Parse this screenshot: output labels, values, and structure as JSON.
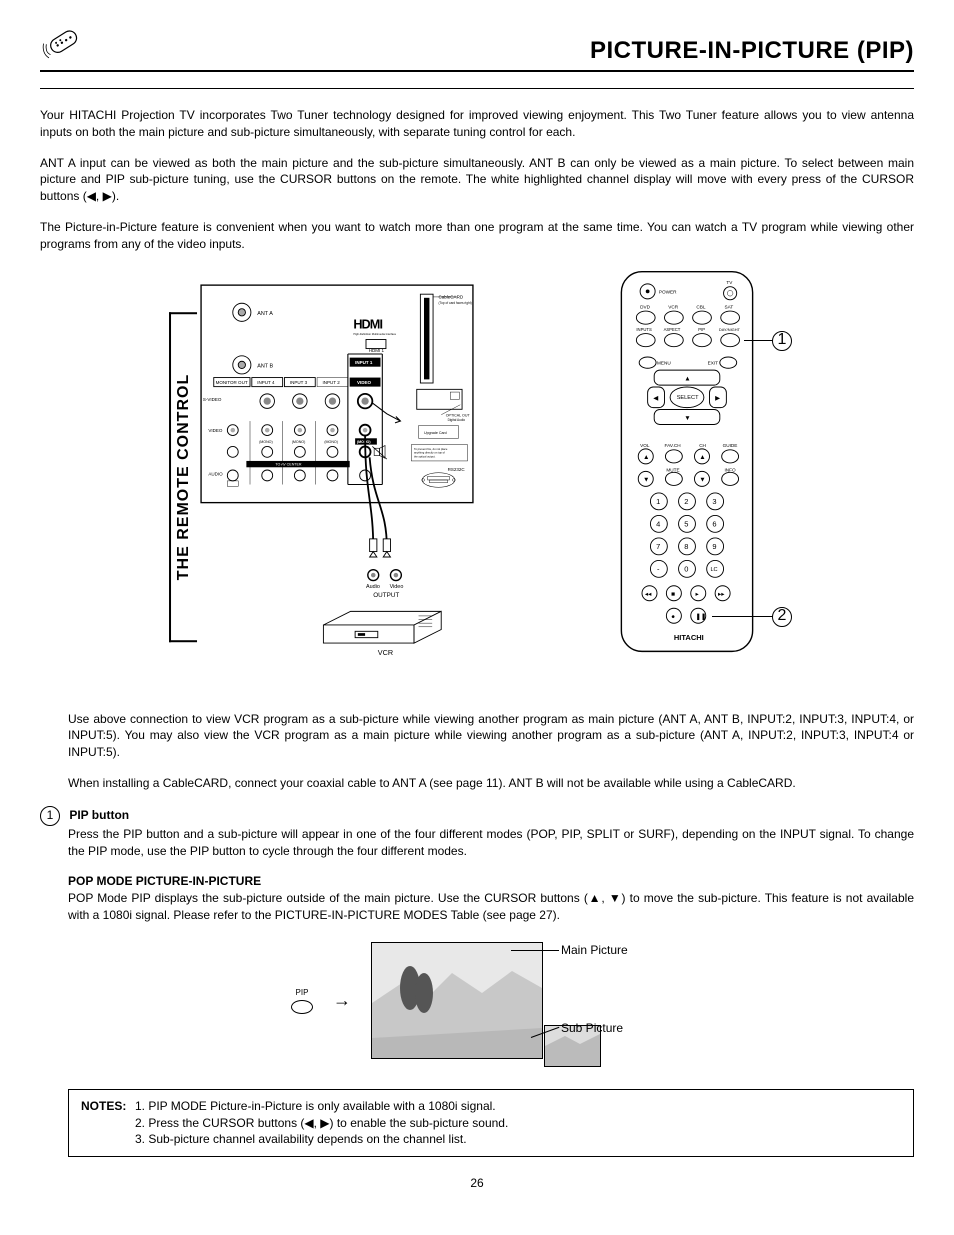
{
  "header": {
    "title": "PICTURE-IN-PICTURE (PIP)"
  },
  "side_label": "THE REMOTE CONTROL",
  "intro": {
    "p1": "Your HITACHI Projection TV incorporates Two Tuner technology designed for improved viewing enjoyment. This Two Tuner feature allows you to view antenna inputs on both the main picture and sub-picture simultaneously, with separate tuning control for each.",
    "p2": "ANT A input can be viewed as both the main picture and the sub-picture simultaneously.  ANT B can only be viewed as a main picture.  To select between main picture and PIP sub-picture tuning, use the CURSOR buttons on the remote.  The white highlighted channel display will move with every press of the CURSOR buttons (◀, ▶).",
    "p3": "The Picture-in-Picture feature is convenient when you want to watch more than one program at the same time.  You can watch a TV program while viewing other programs from any of the video inputs."
  },
  "diagram": {
    "backpanel_labels": {
      "ant_a": "ANT A",
      "ant_b": "ANT B",
      "hdmi": "HDMI",
      "hdmi_sub": "HDMI 1",
      "monitor_out": "MONITOR OUT",
      "input4": "INPUT 4",
      "input3": "INPUT 3",
      "input2": "INPUT 2",
      "input1": "INPUT 1",
      "svideo": "S-VIDEO",
      "video": "VIDEO",
      "audio": "AUDIO",
      "mono": "(MONO)",
      "center": "TO AV CENTER",
      "cablecard": "CableCARD",
      "cablecard_sub": "(Top of card faces right)",
      "optical": "OPTICAL OUT",
      "optical_sub": "Digital Audio",
      "upgrade": "Upgrade Card",
      "rs232c": "RS232C",
      "audio_out": "Audio",
      "video_out": "Video",
      "output": "OUTPUT",
      "vcr": "VCR",
      "caution": "To prevent fire, do not place anything directly on top of the optical output."
    },
    "remote_labels": {
      "power": "POWER",
      "tv": "TV",
      "dvd": "DVD",
      "vcr": "VCR",
      "cbl": "CBL",
      "sat": "SAT",
      "inputs": "INPUTS",
      "aspect": "ASPECT",
      "pip": "PIP",
      "daynight": "DAY/NIGHT",
      "menu": "MENU",
      "exit": "EXIT",
      "select": "SELECT",
      "vol": "VOL",
      "favch": "FAV.CH",
      "ch": "CH",
      "guide": "GUIDE",
      "mute": "MUTE",
      "info": "INFO",
      "lc": "LC",
      "brand": "HITACHI"
    },
    "callout1": "1",
    "callout2": "2"
  },
  "after_diagram": {
    "p1": "Use above connection to view VCR program as a sub-picture while viewing another program as main picture (ANT A, ANT B, INPUT:2, INPUT:3, INPUT:4, or INPUT:5). You may also view the VCR program as a main picture while viewing another program as a sub-picture (ANT A, INPUT:2, INPUT:3, INPUT:4 or INPUT:5).",
    "p2": "When installing a CableCARD, connect your coaxial cable to ANT A (see page 11). ANT B will not be available while using a CableCARD."
  },
  "sections": {
    "num1": "1",
    "pip_heading": "PIP button",
    "pip_text": "Press the PIP button and a sub-picture will appear in one of the four different modes (POP, PIP, SPLIT or SURF), depending on the INPUT signal.  To change the PIP mode, use the PIP button to cycle through the four different modes.",
    "pop_heading": "POP MODE PICTURE-IN-PICTURE",
    "pop_text": "POP Mode PIP displays the sub-picture outside of the main picture.  Use the CURSOR buttons (▲, ▼) to move the sub-picture.  This feature is not available with a 1080i signal.  Please refer to the PICTURE-IN-PICTURE MODES Table (see page 27)."
  },
  "pip_illustration": {
    "pip_btn": "PIP",
    "main_label": "Main Picture",
    "sub_label": "Sub Picture"
  },
  "notes": {
    "label": "NOTES:",
    "items": [
      "PIP MODE Picture-in-Picture is only available with a 1080i signal.",
      "Press the CURSOR buttons (◀, ▶) to enable the sub-picture sound.",
      "Sub-picture channel availability depends on the channel list."
    ]
  },
  "page_number": "26"
}
